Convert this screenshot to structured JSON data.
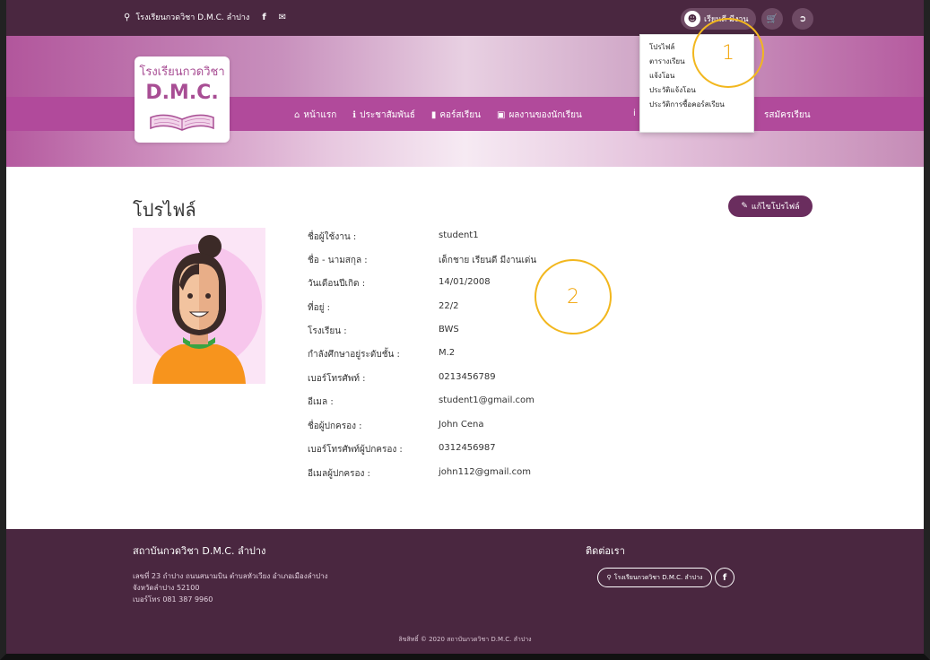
{
  "topbar": {
    "school_link": "โรงเรียนกวดวิชา D.M.C. ลำปาง",
    "user_name": "เรียนดี มีงาน"
  },
  "logo": {
    "line1": "โรงเรียนกวดวิชา",
    "line2": "D.M.C."
  },
  "nav": {
    "items": [
      {
        "icon": "home-icon",
        "label": "หน้าแรก"
      },
      {
        "icon": "info-icon",
        "label": "ประชาสัมพันธ์"
      },
      {
        "icon": "book-icon",
        "label": "คอร์สเรียน"
      },
      {
        "icon": "id-card-icon",
        "label": "ผลงานของนักเรียน"
      }
    ],
    "extra_icon": "i",
    "right_label": "รสมัครเรียน"
  },
  "dropdown": {
    "items": [
      "โปรไฟล์",
      "ตารางเรียน",
      "แจ้งโอน",
      "ประวัติแจ้งโอน",
      "ประวัติการซื้อคอร์สเรียน"
    ]
  },
  "annotations": {
    "ring1": "1",
    "ring2": "2"
  },
  "profile": {
    "title": "โปรไฟล์",
    "edit_label": "แก้ไขโปรไฟล์",
    "fields": [
      {
        "label": "ชื่อผู้ใช้งาน :",
        "value": "student1"
      },
      {
        "label": "ชื่อ - นามสกุล :",
        "value": "เด็กชาย เรียนดี มีงานเด่น"
      },
      {
        "label": "วันเดือนปีเกิด :",
        "value": "14/01/2008"
      },
      {
        "label": "ที่อยู่ :",
        "value": "22/2"
      },
      {
        "label": "โรงเรียน :",
        "value": "BWS"
      },
      {
        "label": "กำลังศึกษาอยู่ระดับชั้น :",
        "value": "M.2"
      },
      {
        "label": "เบอร์โทรศัพท์ :",
        "value": "0213456789"
      },
      {
        "label": "อีเมล :",
        "value": "student1@gmail.com"
      },
      {
        "label": "ชื่อผู้ปกครอง :",
        "value": "John Cena"
      },
      {
        "label": "เบอร์โทรศัพท์ผู้ปกครอง :",
        "value": "0312456987"
      },
      {
        "label": "อีเมลผู้ปกครอง :",
        "value": "john112@gmail.com"
      }
    ]
  },
  "footer": {
    "title": "สถาบันกวดวิชา D.M.C. ลำปาง",
    "address_lines": [
      "เลขที่ 23 ถำปาง ถนนสนามบิน ตำบลหัวเวียง อำเภอเมืองลำปาง",
      "จังหวัดลำปาง 52100",
      "เบอร์โทร 081 387 9960"
    ],
    "contact_title": "ติดต่อเรา",
    "contact_pill": "โรงเรียนกวดวิชา D.M.C. ลำปาง",
    "copyright": "ลิขสิทธิ์ © 2020 สถาบันกวดวิชา D.M.C. ลำปาง"
  }
}
